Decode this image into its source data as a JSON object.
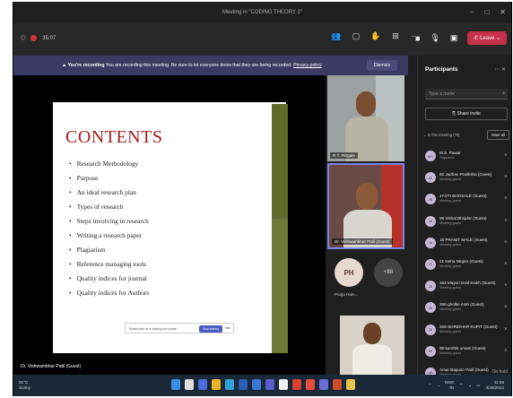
{
  "window": {
    "title": "Meeting in \"CODING THEORY 3\"",
    "controls": [
      "−",
      "□",
      "✕"
    ]
  },
  "toolbar": {
    "elapsed": "35:07",
    "leave_label": "Leave"
  },
  "banner": {
    "heading": "You're recording",
    "message": "You are recording this meeting. Be sure to let everyone know that they are being recorded.",
    "link": "Privacy policy",
    "dismiss": "Dismiss"
  },
  "slide": {
    "title": "CONTENTS",
    "items": [
      "Research Methodology",
      "Purpose",
      "An ideal research plan",
      "Types of research",
      "Steps involving in research",
      "Writing a research paper",
      "Plagiarism",
      "Reference managing tools",
      "Quality indices for journal",
      "Quality indices for Authors"
    ],
    "share_notice": "Shaaniomin.on is sharing your screen",
    "stop_sharing": "Stop sharing",
    "hide": "Hide",
    "presenter": "Dr. Vishwambhar Patil (Guest)"
  },
  "video_tiles": {
    "tile1_name": "R.T. Pingale",
    "tile2_name": "Dr. Vishwambhar Patil (Guest)",
    "avatar_initials": "PH",
    "avatar_caption": "Pooja Ham...",
    "more_label": "+88"
  },
  "participants": {
    "title": "Participants",
    "search_placeholder": "Type a name",
    "share_invite": "Share invite",
    "section": "In this meeting (75)",
    "mute_all": "Mute all",
    "list": [
      {
        "name": "M.S. Pawar",
        "role": "Organizer",
        "initials": "MS"
      },
      {
        "name": "82 Jadhav Pratiksha (Guest)",
        "role": "Meeting guest",
        "initials": "82"
      },
      {
        "name": "JYOTI BHOSALE (Guest)",
        "role": "Meeting guest",
        "initials": "JB"
      },
      {
        "name": "06 Vishal Bhojdar (Guest)",
        "role": "Meeting guest",
        "initials": "06"
      },
      {
        "name": "18 PRANIT MALE (Guest)",
        "role": "Meeting guest",
        "initials": "18"
      },
      {
        "name": "21 Neha Nirgire (Guest)",
        "role": "Meeting guest",
        "initials": "21"
      },
      {
        "name": "263 Mayuri Deshmukh (Guest)",
        "role": "Meeting guest",
        "initials": "26"
      },
      {
        "name": "265-gholke moh (Guest)",
        "role": "Meeting guest",
        "initials": "26"
      },
      {
        "name": "266-SHRIDHAR KUPIT (Guest)",
        "role": "Meeting guest",
        "initials": "26"
      },
      {
        "name": "89-kamble umais (Guest)",
        "role": "Meeting guest",
        "initials": "89"
      },
      {
        "name": "Amar Bapuso Patil (Guest)",
        "role": "Meeting guest",
        "initials": "AB"
      }
    ],
    "on_hold": "On hold"
  },
  "taskbar": {
    "temp": "31°C",
    "weather": "Sunny",
    "lang1": "ENG",
    "lang2": "IN",
    "time": "11:56",
    "date": "4/28/2022"
  }
}
